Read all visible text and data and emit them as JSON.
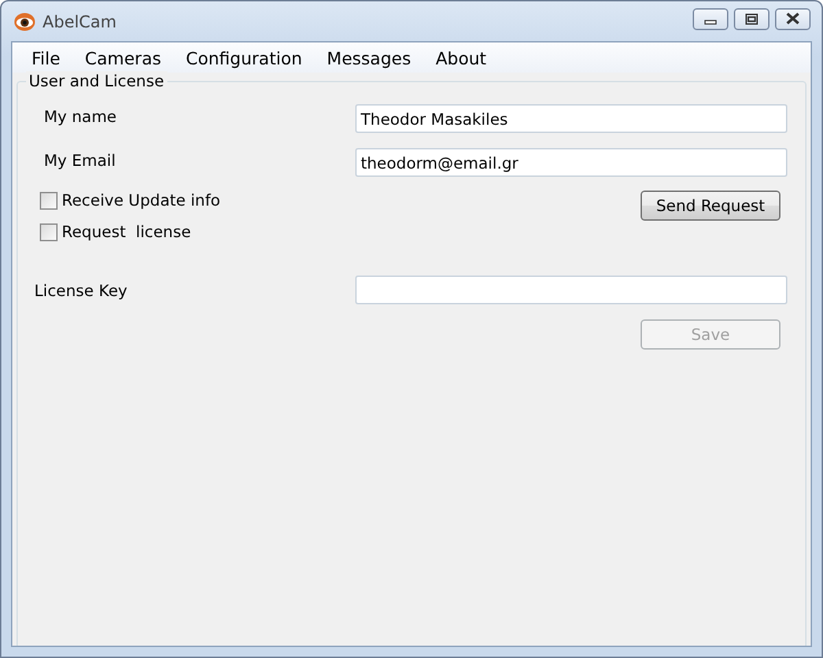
{
  "window": {
    "title": "AbelCam",
    "controls": [
      {
        "kind": "minimize"
      },
      {
        "kind": "maximize"
      },
      {
        "kind": "close"
      }
    ]
  },
  "menu": [
    "File",
    "Cameras",
    "Configuration",
    "Messages",
    "About"
  ],
  "group": {
    "title": "User and License",
    "fields": [
      {
        "label": "My name",
        "value": "Theodor Masakiles"
      },
      {
        "label": "My Email",
        "value": "theodorm@email.gr"
      }
    ],
    "checkboxes": [
      {
        "label": "Receive Update info",
        "checked": false
      },
      {
        "label": "Request  license",
        "checked": false
      }
    ],
    "send_button": {
      "label": "Send Request",
      "disabled": false
    },
    "license": {
      "label": "License Key"
    },
    "save_button": {
      "label": "Save",
      "disabled": true
    }
  }
}
